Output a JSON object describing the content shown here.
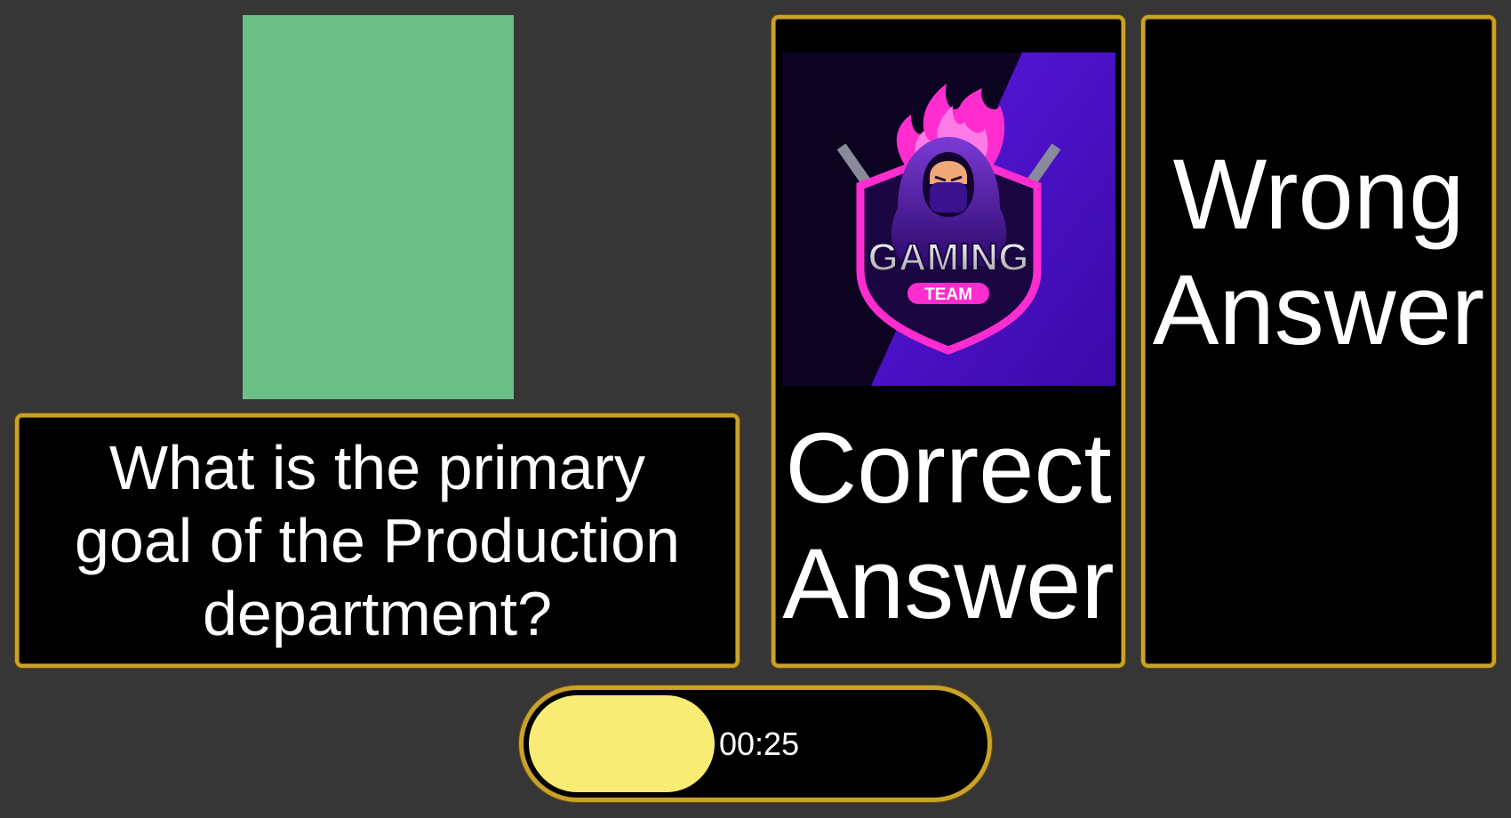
{
  "question": {
    "text": "What is the primary goal of the Production department?"
  },
  "answers": [
    {
      "label": "Correct\nAnswer",
      "logo_text": "GAMING",
      "logo_badge": "TEAM"
    },
    {
      "label": "Wrong\nAnswer"
    }
  ],
  "timer": {
    "text": "00:25",
    "progress": 0.41
  },
  "colors": {
    "background": "#363636",
    "gold": "#c9a227",
    "image_placeholder": "#6bbf87",
    "timer_fill": "#f9ec74",
    "logo_pink": "#ff2ccf",
    "logo_purple": "#4a0fd0"
  },
  "icons": [
    "ninja-gaming-logo"
  ]
}
